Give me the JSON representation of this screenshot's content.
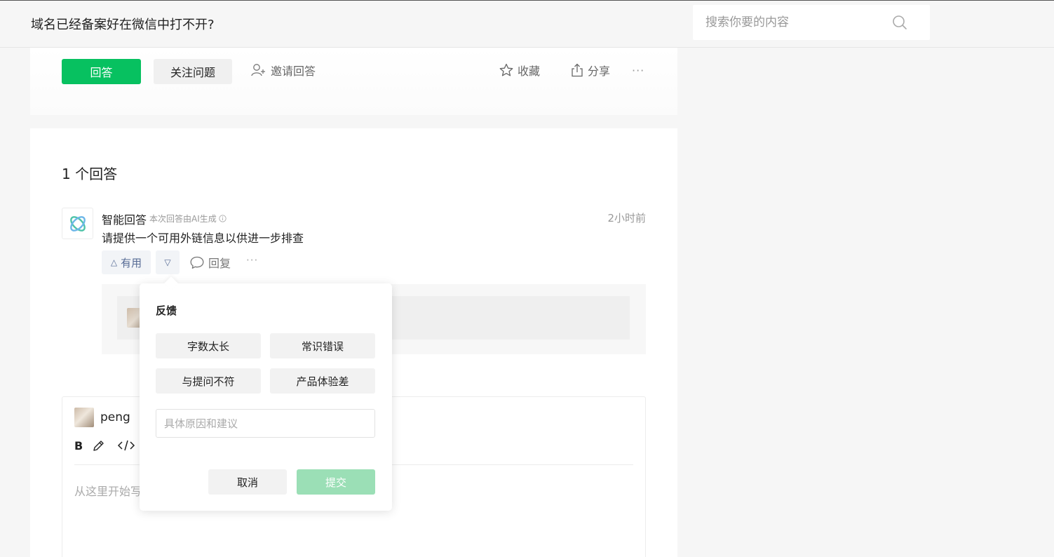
{
  "header": {
    "question_title": "域名已经备案好在微信中打不开?",
    "search_placeholder": "搜索你要的内容"
  },
  "question_actions": {
    "answer_label": "回答",
    "follow_label": "关注问题",
    "invite_label": "邀请回答",
    "favorite_label": "收藏",
    "share_label": "分享",
    "more_label": "···"
  },
  "answers": {
    "count_label": "1 个回答",
    "items": [
      {
        "author": "智能回答",
        "note": "本次回答由AI生成",
        "time": "2小时前",
        "content": "请提供一个可用外链信息以供进一步排查",
        "useful_label": "有用",
        "useful_icon": "△",
        "down_icon": "▽",
        "reply_label": "回复",
        "more_label": "···"
      }
    ]
  },
  "editor": {
    "username": "peng",
    "toolbar": {
      "bold_label": "B"
    },
    "placeholder": "从这里开始写"
  },
  "feedback": {
    "title": "反馈",
    "options": [
      "字数太长",
      "常识错误",
      "与提问不符",
      "产品体验差"
    ],
    "input_placeholder": "具体原因和建议",
    "cancel_label": "取消",
    "submit_label": "提交"
  },
  "colors": {
    "brand_green": "#07c160",
    "submit_disabled": "#9bdfb6",
    "link_blue": "#576b95"
  }
}
